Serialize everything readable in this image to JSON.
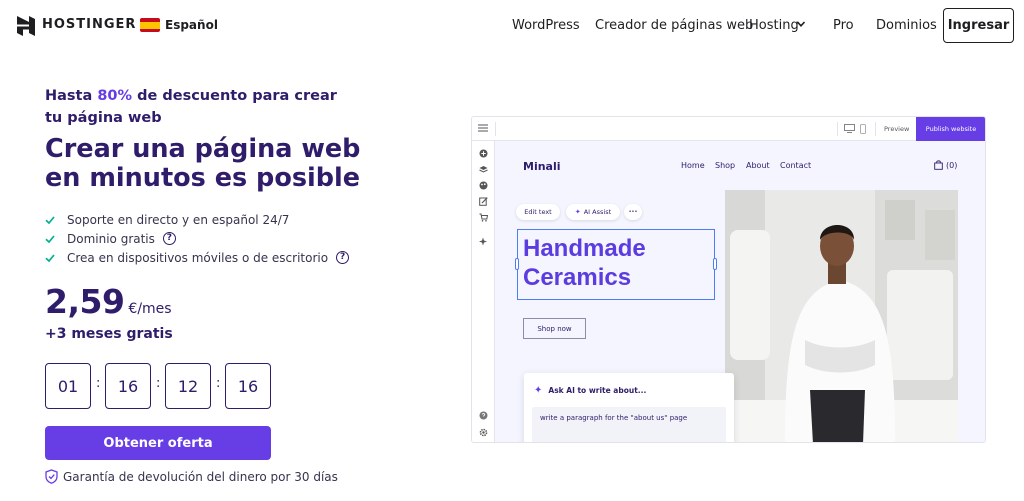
{
  "header": {
    "brand": "HOSTINGER",
    "language": "Español",
    "nav": [
      "WordPress",
      "Creador de páginas web",
      "Hosting",
      "Pro",
      "Dominios"
    ],
    "login": "Ingresar"
  },
  "hero": {
    "promo_prefix": "Hasta ",
    "promo_accent": "80%",
    "promo_suffix": " de descuento para crear tu página web",
    "headline": "Crear una página web en minutos es posible",
    "features": [
      "Soporte en directo y en español 24/7",
      "Dominio gratis",
      "Crea en dispositivos móviles o de escritorio"
    ],
    "help_glyph": "?",
    "price": "2,59",
    "price_unit": "€/mes",
    "bonus": "+3 meses gratis",
    "timer": [
      "01",
      "16",
      "12",
      "16"
    ],
    "timer_separator": ":",
    "cta": "Obtener oferta",
    "guarantee": "Garantía de devolución del dinero por 30 días"
  },
  "builder": {
    "preview": "Preview",
    "publish": "Publish website",
    "site": {
      "logo": "Minali",
      "nav": [
        "Home",
        "Shop",
        "About",
        "Contact"
      ],
      "cart": "(0)",
      "edit_text": "Edit text",
      "ai_assist": "AI Assist",
      "more": "•••",
      "title_line1": "Handmade",
      "title_line2": "Ceramics",
      "shop_now": "Shop now"
    },
    "ai": {
      "title": "Ask AI to write about...",
      "prompt": "write a paragraph for the \"about us\" page"
    }
  },
  "colors": {
    "brand_purple": "#673de6",
    "navy": "#2f1c6a",
    "success_green": "#00b090",
    "selection_blue": "#4d7df2"
  }
}
